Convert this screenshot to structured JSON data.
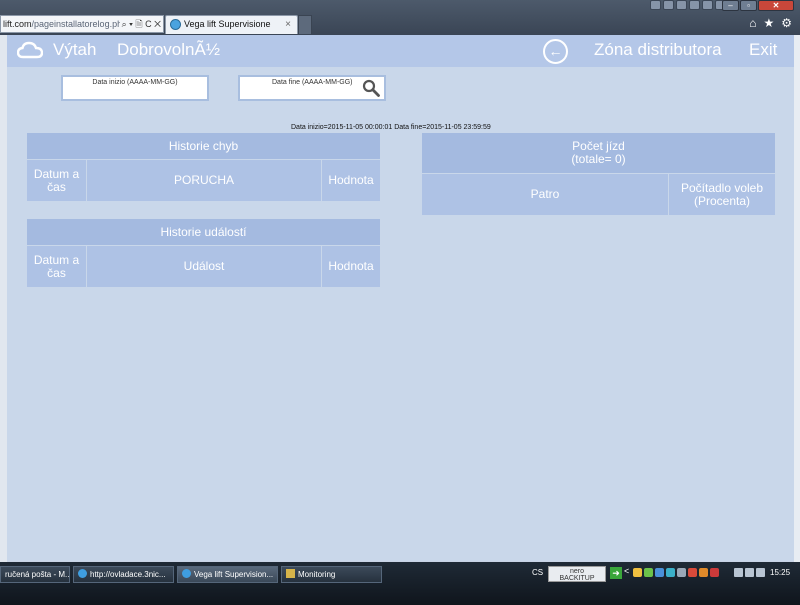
{
  "browser": {
    "address_host": "lift.com",
    "address_path": "/pageinstallatorelog.ph",
    "tab_title": "Vega lift Supervisione",
    "tab_close": "×",
    "nav_icons": "⌕ ▾ 🗎 C ✕",
    "tool_icons": [
      "⌂",
      "★",
      "⚙"
    ]
  },
  "header": {
    "title": "Výtah",
    "subtitle": "DobrovolnÃ½",
    "back_symbol": "←",
    "zone_label": "Zóna distributora",
    "exit_label": "Exit"
  },
  "filters": {
    "start_label": "Data inizio (AAAA-MM-GG)",
    "end_label": "Data fine (AAAA-MM-GG)",
    "range_text": "Data inizio=2015-11-05 00:00:01 Data fine=2015-11-05 23:59:59"
  },
  "faults_table": {
    "title": "Historie chyb",
    "col_datetime": "Datum a čas",
    "col_fault": "PORUCHA",
    "col_value": "Hodnota"
  },
  "events_table": {
    "title": "Historie událostí",
    "col_datetime": "Datum a čas",
    "col_event": "Událost",
    "col_value": "Hodnota"
  },
  "rides_table": {
    "title_line1": "Počet jízd",
    "title_line2": "(totale= 0)",
    "col_floor": "Patro",
    "col_counter": "Počítadlo voleb (Procenta)"
  },
  "taskbar": {
    "items": [
      "ručená pošta - M...",
      "http://ovladace.3nic...",
      "Vega lift Supervision...",
      "Monitoring"
    ],
    "lang": "CS",
    "nero_line1": "nero",
    "nero_line2": "BACKITUP",
    "tray_chevron": "<",
    "clock": "15:25"
  }
}
